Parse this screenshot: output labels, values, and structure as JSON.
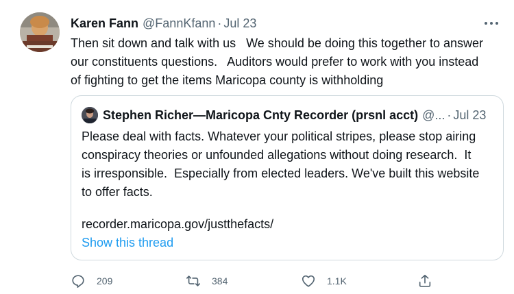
{
  "tweet": {
    "author_name": "Karen Fann",
    "author_handle": "@FannKfann",
    "separator": "·",
    "date": "Jul 23",
    "text_lines": [
      "Then sit down and talk with us   We should be doing this together to answer",
      "our constituents questions.   Auditors would prefer to work with you instead",
      "of fighting to get the items Maricopa county is withholding"
    ]
  },
  "quoted_tweet": {
    "author_name": "Stephen Richer—Maricopa Cnty Recorder (prsnl acct)",
    "author_handle": "@...",
    "separator": "·",
    "date": "Jul 23",
    "text_lines": [
      "Please deal with facts. Whatever your political stripes, please stop airing",
      "conspiracy theories or unfounded allegations without doing research.  It",
      "is irresponsible.  Especially from elected leaders. We've built this website",
      "to offer facts."
    ],
    "link": "recorder.maricopa.gov/justthefacts/",
    "show_thread": "Show this thread"
  },
  "actions": {
    "reply": {
      "icon": "reply-icon",
      "count": "209"
    },
    "retweet": {
      "icon": "retweet-icon",
      "count": "384"
    },
    "like": {
      "icon": "heart-icon",
      "count": "1.1K"
    },
    "share": {
      "icon": "share-icon"
    }
  },
  "colors": {
    "text": "#0f1419",
    "secondary": "#536471",
    "accent": "#1d9bf0",
    "border": "#cfd9de"
  }
}
